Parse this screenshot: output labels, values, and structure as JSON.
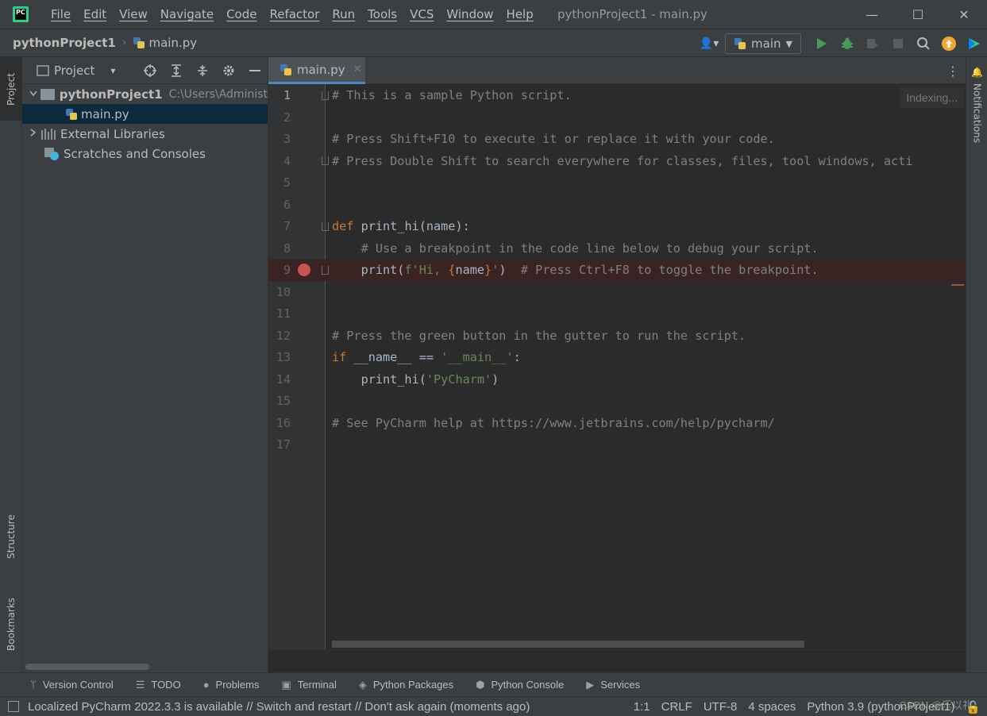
{
  "window": {
    "title": "pythonProject1 - main.py",
    "app_logo_text": "PC",
    "controls": {
      "minimize": "—",
      "maximize": "☐",
      "close": "✕"
    }
  },
  "menu": [
    "File",
    "Edit",
    "View",
    "Navigate",
    "Code",
    "Refactor",
    "Run",
    "Tools",
    "VCS",
    "Window",
    "Help"
  ],
  "navbar": {
    "project": "pythonProject1",
    "separator": "›",
    "file": "main.py",
    "run_config": "main",
    "user_icon": "👤▾"
  },
  "left_stripe": {
    "project": "Project",
    "structure": "Structure",
    "bookmarks": "Bookmarks"
  },
  "right_stripe": {
    "notifications": "Notifications"
  },
  "project_panel": {
    "title": "Project",
    "title_arrow": "▾",
    "tree": [
      {
        "label": "pythonProject1",
        "path": "C:\\Users\\Administ",
        "chevron": "v"
      },
      {
        "label": "main.py"
      },
      {
        "label": "External Libraries",
        "chevron": ">"
      },
      {
        "label": "Scratches and Consoles"
      }
    ]
  },
  "editor": {
    "tab_label": "main.py",
    "tab_close": "✕",
    "indexing": "Indexing...",
    "line_numbers": [
      "1",
      "2",
      "3",
      "4",
      "5",
      "6",
      "7",
      "8",
      "9",
      "10",
      "11",
      "12",
      "13",
      "14",
      "15",
      "16",
      "17"
    ],
    "current_line": 1,
    "breakpoint_line": 9,
    "lines": [
      [
        {
          "t": "# This is a sample Python script.",
          "c": "comment"
        }
      ],
      [],
      [
        {
          "t": "# Press Shift+F10 to execute it or replace it with your code.",
          "c": "comment"
        }
      ],
      [
        {
          "t": "# Press Double Shift to search everywhere for classes, files, tool windows, acti",
          "c": "comment"
        }
      ],
      [],
      [],
      [
        {
          "t": "def ",
          "c": "kw"
        },
        {
          "t": "print_hi(name):",
          "c": "plain"
        }
      ],
      [
        {
          "t": "    # Use a breakpoint in the code line below to debug your script.",
          "c": "comment"
        }
      ],
      [
        {
          "t": "    print(",
          "c": "plain"
        },
        {
          "t": "f'Hi, ",
          "c": "str"
        },
        {
          "t": "{",
          "c": "brace"
        },
        {
          "t": "name",
          "c": "plain"
        },
        {
          "t": "}",
          "c": "brace"
        },
        {
          "t": "'",
          "c": "str"
        },
        {
          "t": ")  ",
          "c": "plain"
        },
        {
          "t": "# Press Ctrl+F8 to toggle the breakpoint.",
          "c": "comment"
        }
      ],
      [],
      [],
      [
        {
          "t": "# Press the green button in the gutter to run the script.",
          "c": "comment"
        }
      ],
      [
        {
          "t": "if ",
          "c": "kw"
        },
        {
          "t": "__name__ == ",
          "c": "plain"
        },
        {
          "t": "'__main__'",
          "c": "str"
        },
        {
          "t": ":",
          "c": "plain"
        }
      ],
      [
        {
          "t": "    print_hi(",
          "c": "plain"
        },
        {
          "t": "'PyCharm'",
          "c": "str"
        },
        {
          "t": ")",
          "c": "plain"
        }
      ],
      [],
      [
        {
          "t": "# See PyCharm help at https://www.jetbrains.com/help/pycharm/",
          "c": "comment"
        }
      ],
      []
    ]
  },
  "tool_windows": [
    "Version Control",
    "TODO",
    "Problems",
    "Terminal",
    "Python Packages",
    "Python Console",
    "Services"
  ],
  "status": {
    "message": "Localized PyCharm 2022.3.3 is available // Switch and restart // Don't ask again (moments ago)",
    "position": "1:1",
    "line_sep": "CRLF",
    "encoding": "UTF-8",
    "indent": "4 spaces",
    "interpreter": "Python 3.9 (pythonProject1)",
    "watermark": "CSDN @乐以礼"
  },
  "colors": {
    "accent": "#4a88c7",
    "run_green": "#499c54",
    "breakpoint": "#c75450",
    "update_orange": "#f0a732"
  }
}
